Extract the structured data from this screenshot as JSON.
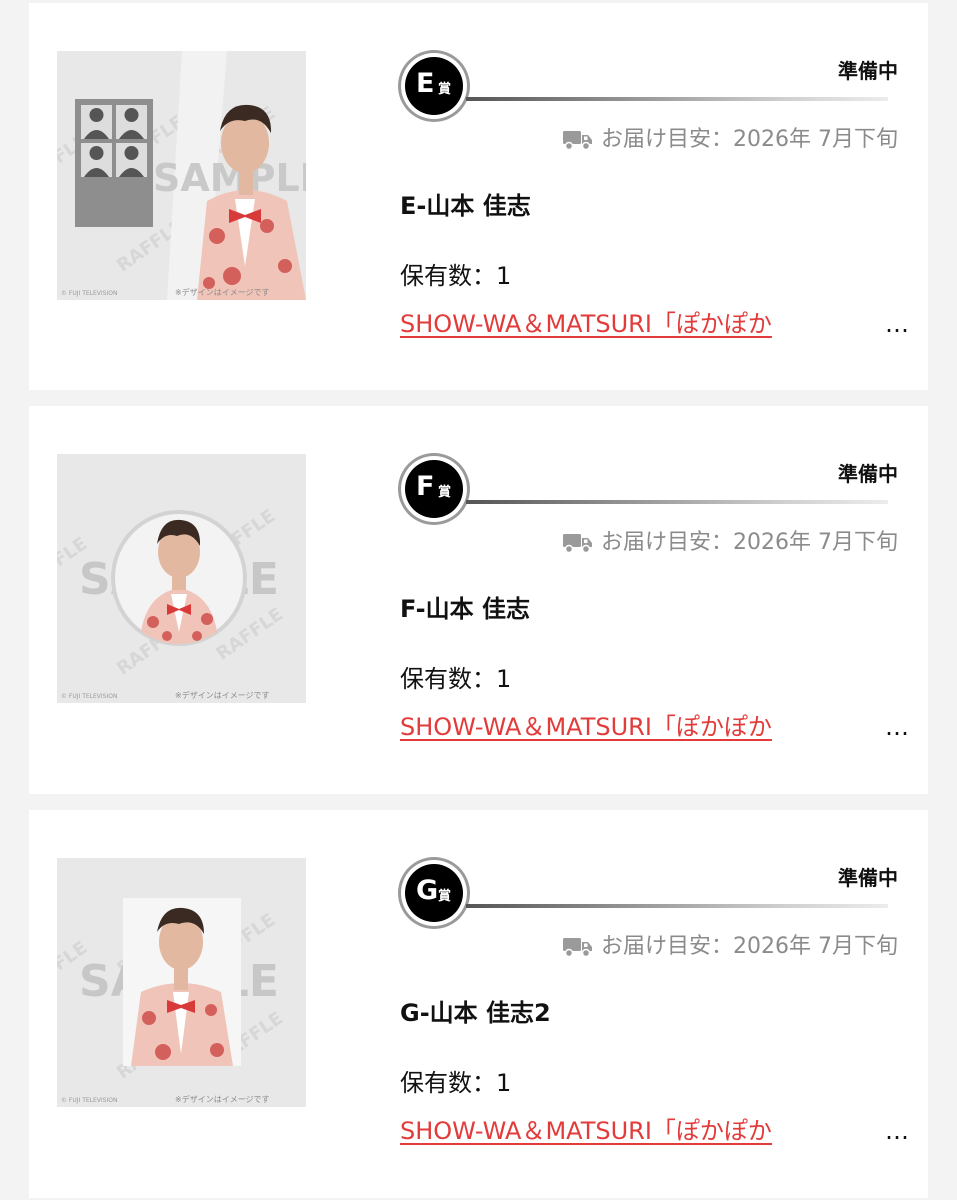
{
  "prizes": [
    {
      "grade": "E",
      "grade_suffix": "賞",
      "status": "準備中",
      "delivery_text": "お届け目安：2026年 7月下旬",
      "item_name": "E-山本 佳志",
      "owned_label": "保有数：1",
      "campaign_link": "SHOW-WA＆MATSURI「ぽかぽか",
      "ellipsis": "…",
      "thumbnail": {
        "type": "photo-frame",
        "watermark": "SAMPLE",
        "pattern_text": "RAFFLE",
        "copyright": "© FUJI TELEVISION",
        "note": "※デザインはイメージです"
      }
    },
    {
      "grade": "F",
      "grade_suffix": "賞",
      "status": "準備中",
      "delivery_text": "お届け目安：2026年 7月下旬",
      "item_name": "F-山本 佳志",
      "owned_label": "保有数：1",
      "campaign_link": "SHOW-WA＆MATSURI「ぽかぽか",
      "ellipsis": "…",
      "thumbnail": {
        "type": "can-badge",
        "watermark": "SAMPLE",
        "pattern_text": "RAFFLE",
        "copyright": "© FUJI TELEVISION",
        "note": "※デザインはイメージです"
      }
    },
    {
      "grade": "G",
      "grade_suffix": "賞",
      "status": "準備中",
      "delivery_text": "お届け目安：2026年 7月下旬",
      "item_name": "G-山本 佳志2",
      "owned_label": "保有数：1",
      "campaign_link": "SHOW-WA＆MATSURI「ぽかぽか",
      "ellipsis": "…",
      "thumbnail": {
        "type": "square-photo",
        "watermark": "SAMPLE",
        "pattern_text": "RAFFLE",
        "copyright": "© FUJI TELEVISION",
        "note": "※デザインはイメージです"
      }
    }
  ],
  "colors": {
    "page_background": "#f3f3f3",
    "card_background": "#ffffff",
    "link_red": "#e33a3a",
    "muted_gray": "#8b8b8b",
    "badge_black": "#000000"
  },
  "icons": {
    "delivery": "truck-icon",
    "grade_badge": "prize-grade-badge"
  }
}
